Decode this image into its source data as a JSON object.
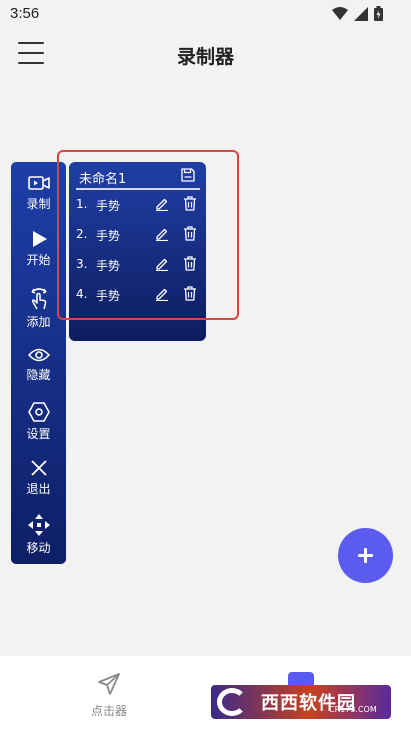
{
  "status_bar": {
    "time": "3:56"
  },
  "app_bar": {
    "title": "录制器"
  },
  "toolbar": {
    "items": [
      {
        "label": "录制",
        "icon": "video-record-icon"
      },
      {
        "label": "开始",
        "icon": "play-icon"
      },
      {
        "label": "添加",
        "icon": "tap-gesture-icon"
      },
      {
        "label": "隐藏",
        "icon": "eye-icon"
      },
      {
        "label": "设置",
        "icon": "gear-hexagon-icon"
      },
      {
        "label": "退出",
        "icon": "close-icon"
      },
      {
        "label": "移动",
        "icon": "move-arrows-icon"
      }
    ]
  },
  "script_panel": {
    "name": "未命名1",
    "gestures": [
      {
        "index": "1.",
        "name": "手势"
      },
      {
        "index": "2.",
        "name": "手势"
      },
      {
        "index": "3.",
        "name": "手势"
      },
      {
        "index": "4.",
        "name": "手势"
      }
    ]
  },
  "bottom_nav": {
    "items": [
      {
        "label": "点击器",
        "icon": "paper-plane-icon"
      }
    ]
  },
  "watermark": {
    "brand": "西西软件园",
    "url": "CR173.COM"
  },
  "colors": {
    "accent": "#5b5bf0",
    "toolbar_top": "#1e3ea8",
    "toolbar_bottom": "#0e1f66",
    "highlight": "#d9463b"
  }
}
